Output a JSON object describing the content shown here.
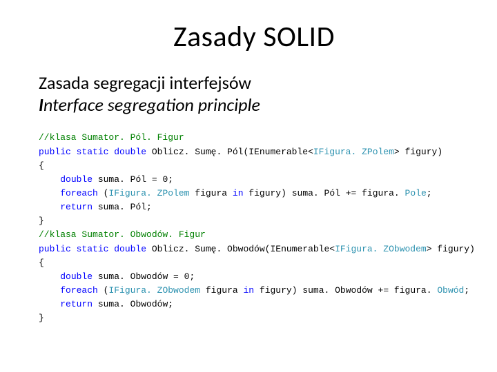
{
  "title": "Zasady SOLID",
  "subtitle": {
    "line1": "Zasada segregacji interfejsów",
    "line2_bold": "I",
    "line2_rest": "nterface segregation principle"
  },
  "code": {
    "l01_comment": "//klasa Sumator. Pól. Figur",
    "l02_kw1": "public static double",
    "l02_rest_a": " Oblicz. Sumę. Pól(IEnumerable<",
    "l02_type": "IFigura. ZPolem",
    "l02_rest_b": "> figury)",
    "l03": "{",
    "l04_kw": "double",
    "l04_rest": " suma. Pól = 0;",
    "l05_kw": "foreach",
    "l05_a": " (",
    "l05_type": "IFigura. ZPolem",
    "l05_b": " figura ",
    "l05_kw2": "in",
    "l05_c": " figury) suma. Pól += figura. ",
    "l05_prop": "Pole",
    "l05_d": ";",
    "l06_kw": "return",
    "l06_rest": " suma. Pól;",
    "l07": "}",
    "l08_comment": "//klasa Sumator. Obwodów. Figur",
    "l09_kw1": "public static double",
    "l09_rest_a": " Oblicz. Sumę. Obwodów(IEnumerable<",
    "l09_type": "IFigura. ZObwodem",
    "l09_rest_b": "> figury)",
    "l10": "{",
    "l11_kw": "double",
    "l11_rest": " suma. Obwodów = 0;",
    "l12_kw": "foreach",
    "l12_a": " (",
    "l12_type": "IFigura. ZObwodem",
    "l12_b": " figura ",
    "l12_kw2": "in",
    "l12_c": " figury) suma. Obwodów += figura. ",
    "l12_prop": "Obwód",
    "l12_d": ";",
    "l13_kw": "return",
    "l13_rest": " suma. Obwodów;",
    "l14": "}"
  }
}
